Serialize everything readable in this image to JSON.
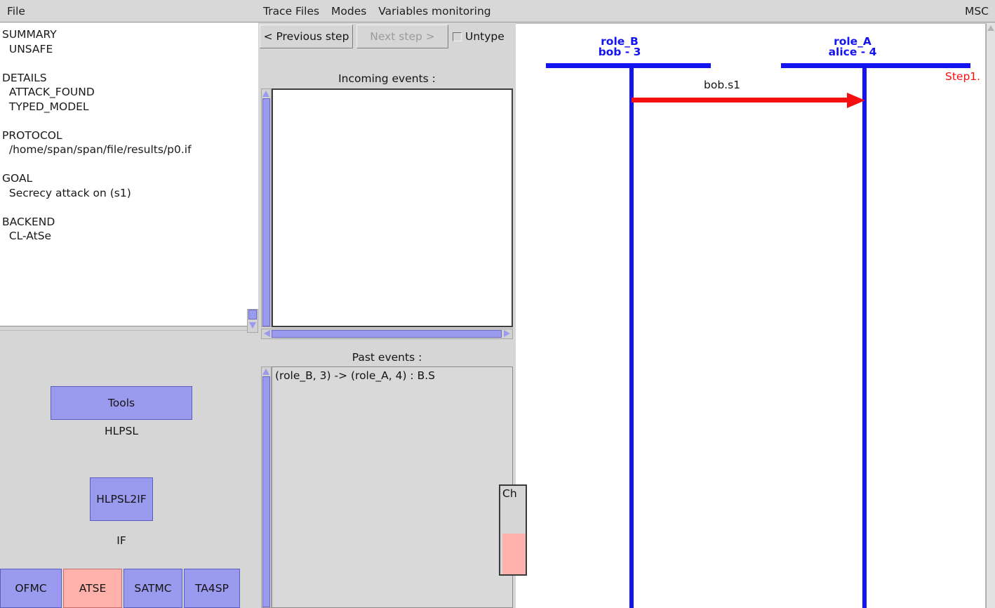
{
  "left": {
    "menu": [
      "File"
    ],
    "summary_report": "SUMMARY\n  UNSAFE\n\nDETAILS\n  ATTACK_FOUND\n  TYPED_MODEL\n\nPROTOCOL\n  /home/span/span/file/results/p0.if\n\nGOAL\n  Secrecy attack on (s1)\n\nBACKEND\n  CL-AtSe",
    "tools": {
      "tools_button": "Tools",
      "hlpsl_label": "HLPSL",
      "hlpsl2if_button": "HLPSL2IF",
      "if_label": "IF",
      "backends": [
        "OFMC",
        "ATSE",
        "SATMC",
        "TA4SP"
      ],
      "selected_backend": "ATSE",
      "button_color": "#9a9aee",
      "selected_color": "#ffb2ac"
    }
  },
  "middle": {
    "menu": [
      "Trace Files",
      "Modes",
      "Variables monitoring"
    ],
    "controls": {
      "previous_step": "< Previous step",
      "next_step": "Next step >",
      "next_step_enabled": false,
      "untype_label": "Untype",
      "untype_checked": false
    },
    "incoming": {
      "header": "Incoming events :",
      "items": []
    },
    "past": {
      "header": "Past events :",
      "items": [
        "(role_B, 3) -> (role_A, 4) : B.S"
      ]
    },
    "floating_window": {
      "title": "Ch"
    }
  },
  "msc": {
    "menu": [
      "MSC"
    ],
    "colors": {
      "lifeline": "#1414f0",
      "message": "#f41010",
      "step": "#f41010"
    },
    "roles": [
      {
        "name": "role_B",
        "agent": "bob - 3"
      },
      {
        "name": "role_A",
        "agent": "alice - 4"
      }
    ],
    "messages": [
      {
        "label": "bob.s1",
        "from": "role_B",
        "to": "role_A"
      }
    ],
    "step_label": "Step1."
  }
}
